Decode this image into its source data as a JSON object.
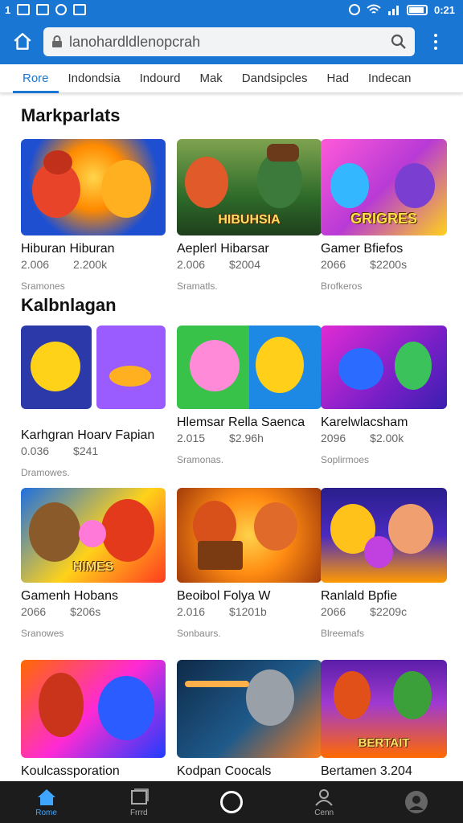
{
  "status_bar": {
    "left": "1",
    "time": "0:21"
  },
  "browser": {
    "url": "lanohardldlenopcrah"
  },
  "tabs": [
    "Rore",
    "Indondsia",
    "Indourd",
    "Mak",
    "Dandsipcles",
    "Had",
    "Indecan"
  ],
  "sections": [
    {
      "title": "Markparlats",
      "cards": [
        {
          "title": "Hiburan Hiburan",
          "meta1": "2.006",
          "meta2": "2.200k",
          "sub": "Sramones",
          "image_label": "",
          "colors": [
            "#1f4fd1",
            "#ff8a00"
          ]
        },
        {
          "title": "Aeplerl Hibarsar",
          "meta1": "2.006",
          "meta2": "$2004",
          "sub": "Sramatls.",
          "image_label": "HIBUHSIA",
          "colors": [
            "#2e6b2a",
            "#e0a030"
          ]
        },
        {
          "title": "Gamer Bfiefos",
          "meta1": "2066",
          "meta2": "$2200s",
          "sub": "Brofkeros",
          "image_label": "GRIGRES",
          "colors": [
            "#d63ad6",
            "#ffd21a"
          ]
        }
      ]
    },
    {
      "title": "Kalbnlagan",
      "cards": [
        {
          "title": "Karhgran Hoarv Fapian",
          "meta1": "0.036",
          "meta2": "$241",
          "sub": "Dramowes.",
          "image_label": "",
          "colors": [
            "#2b3aa8",
            "#9b5cff"
          ]
        },
        {
          "title": "Hlemsar Rella Saenca",
          "meta1": "2.015",
          "meta2": "$2.96h",
          "sub": "Sramonas.",
          "image_label": "",
          "colors": [
            "#39c24a",
            "#1e88e5"
          ]
        },
        {
          "title": "Karelwlacsham",
          "meta1": "2096",
          "meta2": "$2.00k",
          "sub": "Soplirmoes",
          "image_label": "",
          "colors": [
            "#e12bd4",
            "#3a1fb0"
          ]
        }
      ]
    },
    {
      "title": "",
      "cards": [
        {
          "title": "Gamenh Hobans",
          "meta1": "2066",
          "meta2": "$206s",
          "sub": "Sranowes",
          "image_label": "HIMES",
          "colors": [
            "#1e6fe0",
            "#ff3b1f"
          ]
        },
        {
          "title": "Beoibol Folya W",
          "meta1": "2.016",
          "meta2": "$1201b",
          "sub": "Sonbaurs.",
          "image_label": "",
          "colors": [
            "#ff8b12",
            "#a23b0b"
          ]
        },
        {
          "title": "Ranlald Bpfie",
          "meta1": "2066",
          "meta2": "$2209c",
          "sub": "Blreemafs",
          "image_label": "",
          "colors": [
            "#2a1e8c",
            "#ff9a00"
          ]
        }
      ]
    },
    {
      "title": "",
      "cards": [
        {
          "title": "Koulcassporation",
          "meta1": "",
          "meta2": "",
          "sub": "",
          "image_label": "",
          "colors": [
            "#ff6a00",
            "#1e3cff"
          ]
        },
        {
          "title": "Kodpan Coocals",
          "meta1": "",
          "meta2": "",
          "sub": "",
          "image_label": "",
          "colors": [
            "#0f2a48",
            "#ff7a1a"
          ]
        },
        {
          "title": "Bertamen 3.204",
          "meta1": "",
          "meta2": "",
          "sub": "",
          "image_label": "BERTAIT",
          "colors": [
            "#5b1ea8",
            "#ff6a00"
          ]
        }
      ]
    }
  ],
  "bottom_nav": [
    {
      "label": "Rome",
      "icon": "home-icon",
      "active": true
    },
    {
      "label": "Frrrd",
      "icon": "square-icon",
      "active": false
    },
    {
      "label": "",
      "icon": "circle-icon",
      "active": false
    },
    {
      "label": "Cenn",
      "icon": "user-icon",
      "active": false
    },
    {
      "label": "",
      "icon": "avatar-icon",
      "active": false
    }
  ],
  "accent": "#1976d2"
}
